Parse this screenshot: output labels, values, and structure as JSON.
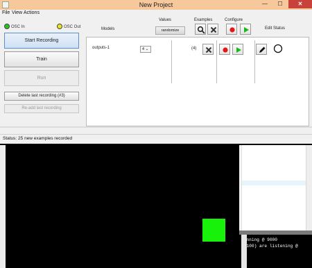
{
  "window": {
    "title": "New Project",
    "min_glyph": "—",
    "max_glyph": "☐",
    "close_glyph": "✕"
  },
  "menu": [
    "File",
    "View",
    "Actions"
  ],
  "osc": {
    "in_label": "OSC In",
    "out_label": "OSC Out",
    "in_color": "#27c227",
    "out_color": "#e6e61c"
  },
  "left_buttons": {
    "start_recording": "Start Recording",
    "train": "Train",
    "run": "Run",
    "delete_last": "Delete last recording (#3)",
    "readd_last": "Re-add last recording"
  },
  "headers": {
    "values": "Values",
    "examples": "Examples",
    "configure": "Configure",
    "models": "Models",
    "edit_status": "Edit Status",
    "randomize": "randomize"
  },
  "model_row": {
    "name": "outputs-1",
    "select_value": "4",
    "count": "(4)"
  },
  "status_bar": {
    "text": "Status:   25 new examples recorded"
  },
  "console_lines": [
    "running @ 9000",
    "8.100) are listening @"
  ],
  "colors": {
    "record": "#e01818",
    "play": "#19b819",
    "canvas_square": "#18f20b"
  }
}
